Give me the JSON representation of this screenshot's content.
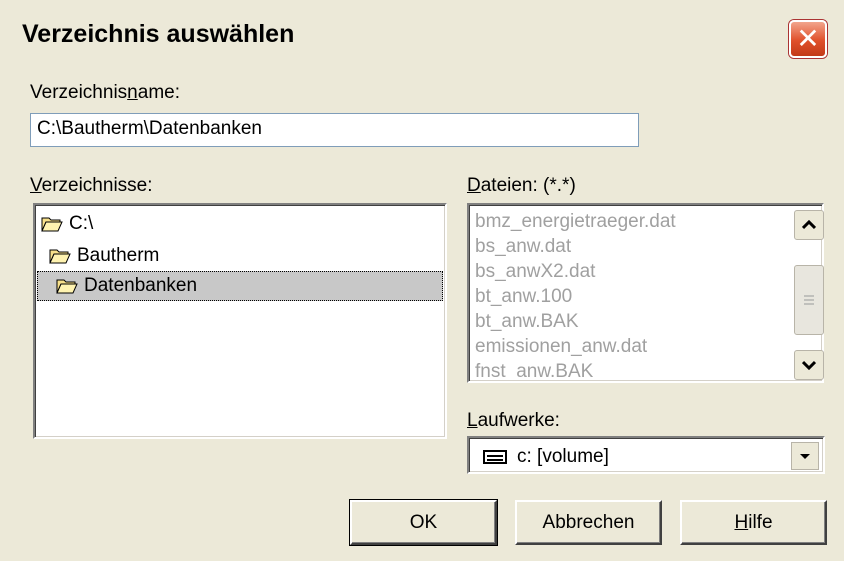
{
  "window": {
    "title": "Verzeichnis auswählen",
    "close_glyph": "✕"
  },
  "dirname": {
    "label_pre": "Verzeichnis",
    "label_u": "n",
    "label_post": "ame:",
    "value": "C:\\Bautherm\\Datenbanken"
  },
  "directories": {
    "label_u": "V",
    "label_post": "erzeichnisse:",
    "items": [
      "C:\\",
      "Bautherm",
      "Datenbanken"
    ]
  },
  "files": {
    "label_u": "D",
    "label_post": "ateien: (*.*)",
    "items": [
      "bmz_energietraeger.dat",
      "bs_anw.dat",
      "bs_anwX2.dat",
      "bt_anw.100",
      "bt_anw.BAK",
      "emissionen_anw.dat",
      "fnst_anw.BAK"
    ]
  },
  "drives": {
    "label_u": "L",
    "label_post": "aufwerke:",
    "value": "c: [volume]"
  },
  "buttons": {
    "ok": "OK",
    "cancel": "Abbrechen",
    "help_u": "H",
    "help_post": "ilfe"
  }
}
